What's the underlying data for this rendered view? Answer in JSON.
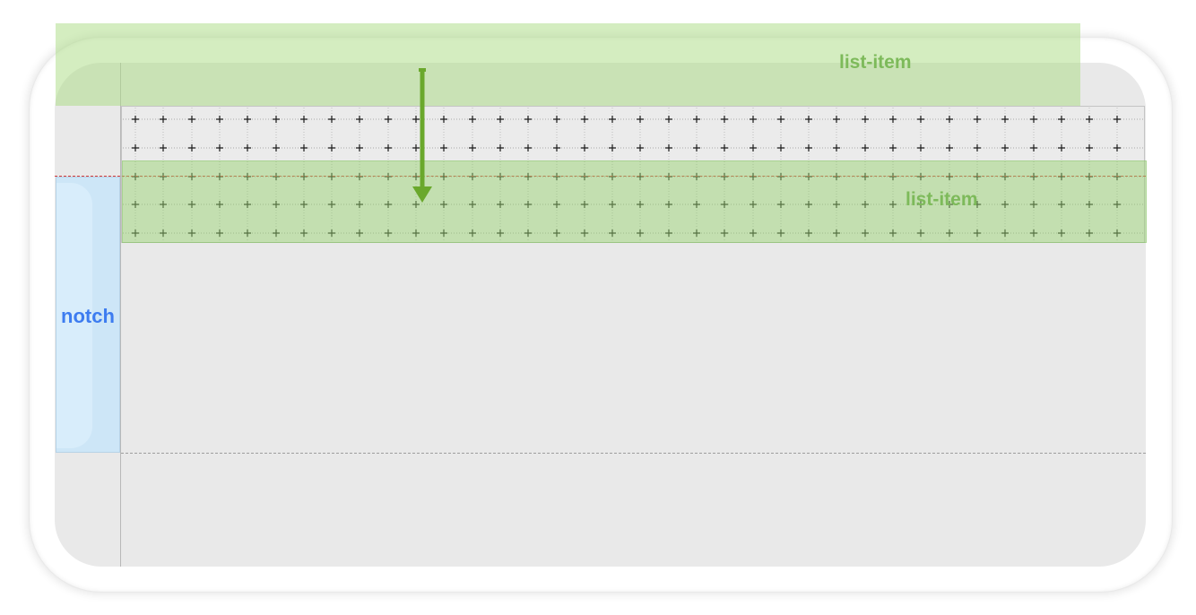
{
  "labels": {
    "top_band": "list-item",
    "mid_band": "list-item",
    "notch": "notch"
  },
  "colors": {
    "band_fill": "#a8d88a",
    "band_label": "#7dba5a",
    "notch_fill": "#cde6f7",
    "notch_label": "#3d7cf0",
    "arrow": "#6aa82c",
    "guide_red": "#d23a3a",
    "guide_gray": "#9d9d9d",
    "screen": "#e9e9e9"
  },
  "icons": {
    "arrow": "arrow-down-icon",
    "grid_mark": "plus-icon"
  }
}
